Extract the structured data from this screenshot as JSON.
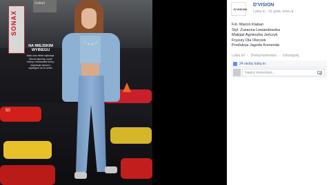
{
  "photo": {
    "banner_text": "SONAX",
    "sign_text": "Gokart",
    "magazine_title": "NA MIEJSKIM WYBIEGU",
    "magazine_body": "Maxi oraz letnie stylizacje. Mocne akcenty, nowe kolory i niebanalne formy. Inspiracje wprost z wybiegów na co dzień.",
    "page_number": "50"
  },
  "post": {
    "avatar_text": "D'VISION",
    "page_name": "D'VISION",
    "like_link": "Lubię to",
    "time_ago": "16 godz. temu",
    "privacy_icon": "globe-icon",
    "caption_lines": [
      "Fot. Marcin Klaban",
      "Styl. Zuzanna Lewandowska",
      "Makijaż Agnieszka Jańczyk",
      "Fryzury Ola Oleczek",
      "Produkcja Jagoda Komenda"
    ],
    "actions": {
      "like": "Lubię to!",
      "comment": "Dodaj komentarz",
      "share": "Udostępnij",
      "separator": "·"
    },
    "likes_text": "24 osoby lubią to.",
    "comment_placeholder": "Napisz komentarz..."
  },
  "colors": {
    "link": "#3b5998",
    "meta": "#90949c",
    "like_badge": "#5890ff"
  }
}
